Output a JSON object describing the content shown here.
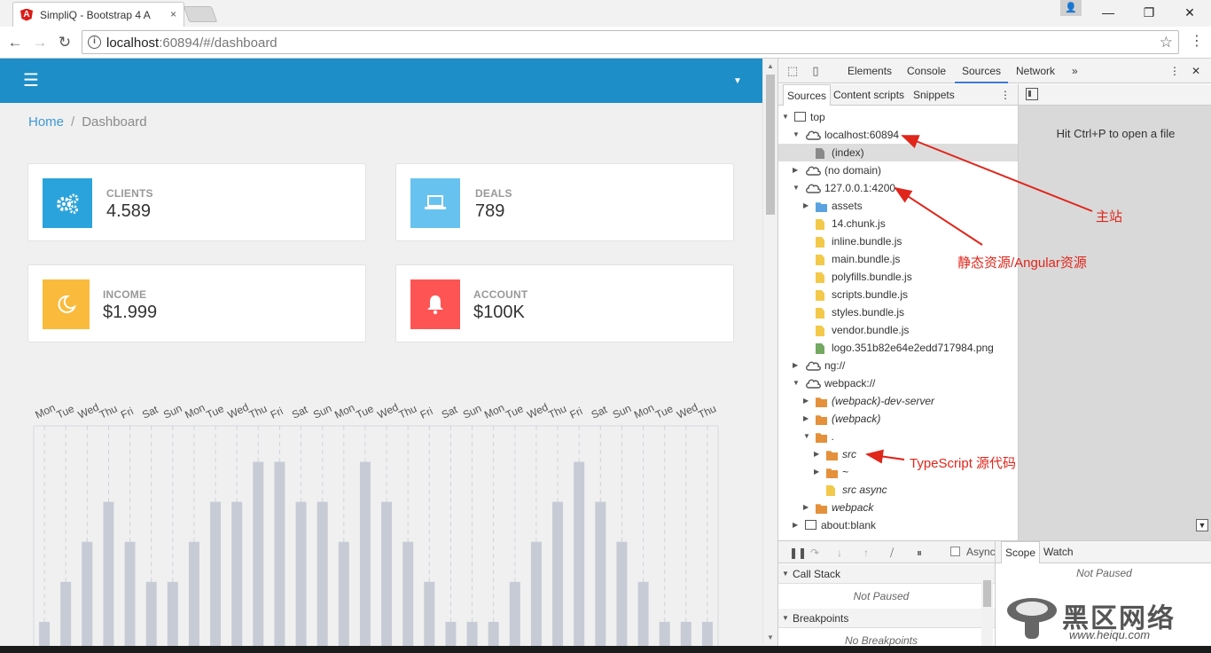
{
  "browser": {
    "tab_title": "SimpliQ - Bootstrap 4 A",
    "tab_close": "×",
    "url_host": "localhost",
    "url_rest": ":60894/#/dashboard",
    "window_min": "—",
    "window_max": "❐",
    "window_close": "✕",
    "back": "←",
    "forward": "→",
    "reload": "↻",
    "star": "☆",
    "menu": "⋮"
  },
  "app": {
    "breadcrumb": {
      "home": "Home",
      "separator": "/",
      "current": "Dashboard"
    },
    "cards": [
      {
        "label": "CLIENTS",
        "value": "4.589",
        "icon": "gears-icon",
        "color": "#2aa3dc"
      },
      {
        "label": "DEALS",
        "value": "789",
        "icon": "laptop-icon",
        "color": "#67c2ef"
      },
      {
        "label": "INCOME",
        "value": "$1.999",
        "icon": "moon-icon",
        "color": "#fabb3d"
      },
      {
        "label": "ACCOUNT",
        "value": "$100K",
        "icon": "bell-icon",
        "color": "#ff5454"
      }
    ]
  },
  "chart_data": {
    "type": "bar",
    "categories": [
      "Mon",
      "Tue",
      "Wed",
      "Thu",
      "Fri",
      "Sat",
      "Sun",
      "Mon",
      "Tue",
      "Wed",
      "Thu",
      "Fri",
      "Sat",
      "Sun",
      "Mon",
      "Tue",
      "Wed",
      "Thu",
      "Fri",
      "Sat",
      "Sun",
      "Mon",
      "Tue",
      "Wed",
      "Thu",
      "Fri",
      "Sat",
      "Sun",
      "Mon",
      "Tue",
      "Wed",
      "Thu"
    ],
    "values": [
      1,
      2,
      3,
      4,
      3,
      2,
      2,
      3,
      4,
      4,
      5,
      5,
      4,
      4,
      3,
      5,
      4,
      3,
      2,
      1,
      1,
      1,
      2,
      3,
      4,
      5,
      4,
      3,
      2,
      1,
      1,
      1
    ],
    "ylim": [
      0,
      5.5
    ],
    "bar_color": "#c7cbd6",
    "grid": true
  },
  "devtools": {
    "tabs": [
      "Elements",
      "Console",
      "Sources",
      "Network"
    ],
    "more": "»",
    "active_tab": "Sources",
    "sub_tabs": [
      "Sources",
      "Content scripts",
      "Snippets"
    ],
    "tree": [
      {
        "label": "top",
        "indent": 0,
        "icon": "frame",
        "open": true
      },
      {
        "label": "localhost:60894",
        "indent": 1,
        "icon": "cloud",
        "open": true
      },
      {
        "label": "(index)",
        "indent": 2,
        "icon": "file-gray",
        "selected": true
      },
      {
        "label": "(no domain)",
        "indent": 1,
        "icon": "cloud",
        "open": false
      },
      {
        "label": "127.0.0.1:4200",
        "indent": 1,
        "icon": "cloud",
        "open": true
      },
      {
        "label": "assets",
        "indent": 2,
        "icon": "folder-blue",
        "open": false
      },
      {
        "label": "14.chunk.js",
        "indent": 2,
        "icon": "file-yellow"
      },
      {
        "label": "inline.bundle.js",
        "indent": 2,
        "icon": "file-yellow"
      },
      {
        "label": "main.bundle.js",
        "indent": 2,
        "icon": "file-yellow"
      },
      {
        "label": "polyfills.bundle.js",
        "indent": 2,
        "icon": "file-yellow"
      },
      {
        "label": "scripts.bundle.js",
        "indent": 2,
        "icon": "file-yellow"
      },
      {
        "label": "styles.bundle.js",
        "indent": 2,
        "icon": "file-yellow"
      },
      {
        "label": "vendor.bundle.js",
        "indent": 2,
        "icon": "file-yellow"
      },
      {
        "label": "logo.351b82e64e2edd717984.png",
        "indent": 2,
        "icon": "file-green"
      },
      {
        "label": "ng://",
        "indent": 1,
        "icon": "cloud",
        "open": false
      },
      {
        "label": "webpack://",
        "indent": 1,
        "icon": "cloud",
        "open": true
      },
      {
        "label": "(webpack)-dev-server",
        "indent": 2,
        "icon": "folder-orange",
        "open": false,
        "italic": true
      },
      {
        "label": "(webpack)",
        "indent": 2,
        "icon": "folder-orange",
        "open": false,
        "italic": true
      },
      {
        "label": ".",
        "indent": 2,
        "icon": "folder-orange",
        "open": true,
        "italic": true
      },
      {
        "label": "src",
        "indent": 3,
        "icon": "folder-orange",
        "open": false,
        "italic": true
      },
      {
        "label": "~",
        "indent": 3,
        "icon": "folder-orange",
        "open": false,
        "italic": true
      },
      {
        "label": "src async",
        "indent": 3,
        "icon": "file-yellow",
        "italic": true
      },
      {
        "label": "webpack",
        "indent": 2,
        "icon": "folder-orange",
        "open": false,
        "italic": true
      },
      {
        "label": "about:blank",
        "indent": 1,
        "icon": "frame",
        "open": false
      }
    ],
    "editor_hint": "Hit Ctrl+P to open a file",
    "async_label": "Async",
    "call_stack": {
      "title": "Call Stack",
      "body": "Not Paused"
    },
    "breakpoints": {
      "title": "Breakpoints",
      "body": "No Breakpoints"
    },
    "scope_tabs": [
      "Scope",
      "Watch"
    ],
    "scope_body": "Not Paused"
  },
  "annotations": {
    "main_site": "主站",
    "static_res": "静态资源/Angular资源",
    "ts_source": "TypeScript 源代码",
    "color": "#e0251b"
  },
  "watermark": {
    "text": "黑区网络",
    "url": "www.heiqu.com"
  }
}
